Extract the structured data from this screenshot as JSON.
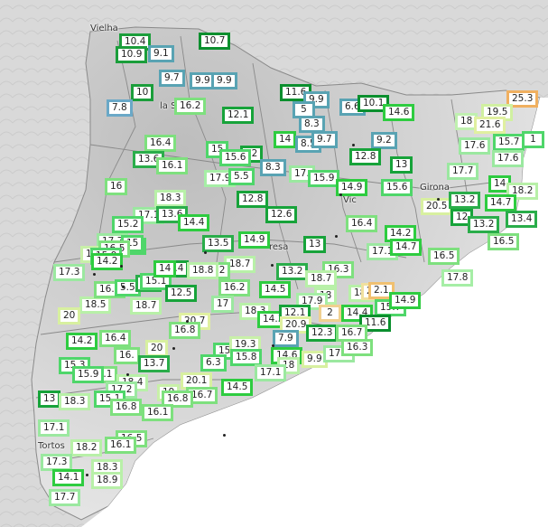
{
  "map": {
    "colors": {
      "background": "#ffffff",
      "land": "#cfcfcf",
      "borders": "#8a8a8a",
      "sea": "#ffffff"
    },
    "places": [
      {
        "name": "Vielha"
      },
      {
        "name": "la S",
        "suffix": "Urge"
      },
      {
        "name": "Girona"
      },
      {
        "name": "resa"
      },
      {
        "name": "Vic"
      },
      {
        "name": "Tortos"
      }
    ],
    "stations": [
      {
        "value": "10.4",
        "color": "#1b9e3b"
      },
      {
        "value": "10.7",
        "color": "#0b8f2e"
      },
      {
        "value": "10.9",
        "color": "#1b9e3b"
      },
      {
        "value": "9.1",
        "color": "#59a3b3"
      },
      {
        "value": "9.7",
        "color": "#59a3b3"
      },
      {
        "value": "9.9",
        "color": "#59a3b3"
      },
      {
        "value": "9.9",
        "color": "#59a3b3"
      },
      {
        "value": "10",
        "color": "#1b9e3b"
      },
      {
        "value": "7.8",
        "color": "#6aa8c7"
      },
      {
        "value": "16.2",
        "color": "#7ee07e"
      },
      {
        "value": "12.1",
        "color": "#17a33a"
      },
      {
        "value": "11.6",
        "color": "#0b8f2e"
      },
      {
        "value": "9.9",
        "color": "#59a3b3"
      },
      {
        "value": "5",
        "color": "#59a3b3"
      },
      {
        "value": "8.3",
        "color": "#59a3b3"
      },
      {
        "value": "6.6",
        "color": "#59a3b3"
      },
      {
        "value": "10.1",
        "color": "#0b8f2e"
      },
      {
        "value": "14.6",
        "color": "#2ecc40"
      },
      {
        "value": "25.3",
        "color": "#f0b060"
      },
      {
        "value": "19.5",
        "color": "#d0f0a0"
      },
      {
        "value": "18",
        "color": "#c0f0b0"
      },
      {
        "value": "21.6",
        "color": "#e0f0a0"
      },
      {
        "value": "14",
        "color": "#2ecc40"
      },
      {
        "value": "8.5",
        "color": "#59a3b3"
      },
      {
        "value": "9.7",
        "color": "#59a3b3"
      },
      {
        "value": "9.2",
        "color": "#59a3b3"
      },
      {
        "value": "16.4",
        "color": "#7ee07e"
      },
      {
        "value": "15",
        "color": "#4fd66a"
      },
      {
        "value": "12",
        "color": "#17a33a"
      },
      {
        "value": "13.6",
        "color": "#2aad4a"
      },
      {
        "value": "15.6",
        "color": "#4fd66a"
      },
      {
        "value": "8.3",
        "color": "#59a3b3"
      },
      {
        "value": "17.6",
        "color": "#9be8a0"
      },
      {
        "value": "15.7",
        "color": "#4fd66a"
      },
      {
        "value": "1",
        "color": "#4fd66a"
      },
      {
        "value": "16.1",
        "color": "#7ee07e"
      },
      {
        "value": "17.9",
        "color": "#a6eea6"
      },
      {
        "value": "5.5",
        "color": "#4fd66a"
      },
      {
        "value": "17.",
        "color": "#9be8a0"
      },
      {
        "value": "15.9",
        "color": "#4fd66a"
      },
      {
        "value": "13",
        "color": "#17a33a"
      },
      {
        "value": "12.8",
        "color": "#17a33a"
      },
      {
        "value": "17.6",
        "color": "#9be8a0"
      },
      {
        "value": "17.7",
        "color": "#9be8a0"
      },
      {
        "value": "14",
        "color": "#2ecc40"
      },
      {
        "value": "16",
        "color": "#7ee07e"
      },
      {
        "value": "14.9",
        "color": "#2ecc40"
      },
      {
        "value": "15.6",
        "color": "#4fd66a"
      },
      {
        "value": "18.2",
        "color": "#b8f0a8"
      },
      {
        "value": "18.3",
        "color": "#b8f0a8"
      },
      {
        "value": "12.8",
        "color": "#17a33a"
      },
      {
        "value": "20.5",
        "color": "#d8f0a0"
      },
      {
        "value": "13.2",
        "color": "#2aad4a"
      },
      {
        "value": "14.7",
        "color": "#2ecc40"
      },
      {
        "value": "17.1",
        "color": "#9be8a0"
      },
      {
        "value": "13.6",
        "color": "#2aad4a"
      },
      {
        "value": "12.6",
        "color": "#17a33a"
      },
      {
        "value": "12",
        "color": "#17a33a"
      },
      {
        "value": "15.2",
        "color": "#4fd66a"
      },
      {
        "value": "14.4",
        "color": "#2ecc40"
      },
      {
        "value": "16.4",
        "color": "#7ee07e"
      },
      {
        "value": "13.2",
        "color": "#2aad4a"
      },
      {
        "value": "13.4",
        "color": "#2aad4a"
      },
      {
        "value": "16.5",
        "color": "#7ee07e"
      },
      {
        "value": "17.7",
        "color": "#9be8a0"
      },
      {
        "value": "15",
        "color": "#4fd66a"
      },
      {
        "value": "15",
        "color": "#4fd66a"
      },
      {
        "value": "14.2",
        "color": "#2ecc40"
      },
      {
        "value": "13.5",
        "color": "#2aad4a"
      },
      {
        "value": "14.9",
        "color": "#2ecc40"
      },
      {
        "value": "13",
        "color": "#17a33a"
      },
      {
        "value": "17.1",
        "color": "#9be8a0"
      },
      {
        "value": "14.7",
        "color": "#2ecc40"
      },
      {
        "value": "16.5",
        "color": "#7ee07e"
      },
      {
        "value": "19",
        "color": "#c8f0a8"
      },
      {
        "value": "16.5",
        "color": "#7ee07e"
      },
      {
        "value": "15.9",
        "color": "#4fd66a"
      },
      {
        "value": "14.2",
        "color": "#2ecc40"
      },
      {
        "value": "18.7",
        "color": "#b8f0a8"
      },
      {
        "value": "17.3",
        "color": "#9be8a0"
      },
      {
        "value": "12.4",
        "color": "#17a33a"
      },
      {
        "value": "16.2",
        "color": "#7ee07e"
      },
      {
        "value": "16.3",
        "color": "#7ee07e"
      },
      {
        "value": "13.2",
        "color": "#2aad4a"
      },
      {
        "value": "17.8",
        "color": "#a6eea6"
      },
      {
        "value": "18.5",
        "color": "#b8f0a8"
      },
      {
        "value": "16.2",
        "color": "#7ee07e"
      },
      {
        "value": "5.5",
        "color": "#4fd66a"
      },
      {
        "value": "3.6",
        "color": "#2aad4a"
      },
      {
        "value": "15.1",
        "color": "#4fd66a"
      },
      {
        "value": "14",
        "color": "#2ecc40"
      },
      {
        "value": "18.8",
        "color": "#b8f0a8"
      },
      {
        "value": "16.2",
        "color": "#7ee07e"
      },
      {
        "value": "12.5",
        "color": "#17a33a"
      },
      {
        "value": "14.5",
        "color": "#2ecc40"
      },
      {
        "value": "18.7",
        "color": "#b8f0a8"
      },
      {
        "value": "18",
        "color": "#b8f0a8"
      },
      {
        "value": "18.8",
        "color": "#b8f0a8"
      },
      {
        "value": "21",
        "color": "#f0e0a0"
      },
      {
        "value": "2.1",
        "color": "#f0c070"
      },
      {
        "value": "15.7",
        "color": "#4fd66a"
      },
      {
        "value": "14.9",
        "color": "#2ecc40"
      },
      {
        "value": "18.7",
        "color": "#b8f0a8"
      },
      {
        "value": "17",
        "color": "#9be8a0"
      },
      {
        "value": "17.9",
        "color": "#a6eea6"
      },
      {
        "value": "2",
        "color": "#f0d090"
      },
      {
        "value": "14.4",
        "color": "#2ecc40"
      },
      {
        "value": "11.6",
        "color": "#0b8f2e"
      },
      {
        "value": "20",
        "color": "#d8f0a0"
      },
      {
        "value": "18.3",
        "color": "#b8f0a8"
      },
      {
        "value": "14.3",
        "color": "#2ecc40"
      },
      {
        "value": "12.1",
        "color": "#17a33a"
      },
      {
        "value": "20.9",
        "color": "#e0f0a0"
      },
      {
        "value": "20.7",
        "color": "#e0f0a0"
      },
      {
        "value": "12.3",
        "color": "#17a33a"
      },
      {
        "value": "16.7",
        "color": "#7ee07e"
      },
      {
        "value": "14.2",
        "color": "#2ecc40"
      },
      {
        "value": "16.4",
        "color": "#7ee07e"
      },
      {
        "value": "16.8",
        "color": "#7ee07e"
      },
      {
        "value": "7.9",
        "color": "#59a3b3"
      },
      {
        "value": "16.",
        "color": "#7ee07e"
      },
      {
        "value": "20",
        "color": "#d8f0a0"
      },
      {
        "value": "15",
        "color": "#4fd66a"
      },
      {
        "value": "19.3",
        "color": "#c8f0a8"
      },
      {
        "value": "14.6",
        "color": "#2ecc40"
      },
      {
        "value": "9.9",
        "color": "#d8f0a0"
      },
      {
        "value": "17.3",
        "color": "#9be8a0"
      },
      {
        "value": "16.3",
        "color": "#7ee07e"
      },
      {
        "value": "15.3",
        "color": "#4fd66a"
      },
      {
        "value": "13.7",
        "color": "#2aad4a"
      },
      {
        "value": "6.3",
        "color": "#4fd66a"
      },
      {
        "value": "15.8",
        "color": "#4fd66a"
      },
      {
        "value": "18",
        "color": "#b8f0a8"
      },
      {
        "value": "16.1",
        "color": "#7ee07e"
      },
      {
        "value": "15.9",
        "color": "#4fd66a"
      },
      {
        "value": "17.1",
        "color": "#9be8a0"
      },
      {
        "value": "20.1",
        "color": "#d8f0a0"
      },
      {
        "value": "14.5",
        "color": "#2ecc40"
      },
      {
        "value": "18.4",
        "color": "#b8f0a8"
      },
      {
        "value": "17.2",
        "color": "#9be8a0"
      },
      {
        "value": "19",
        "color": "#c8f0a8"
      },
      {
        "value": "16.7",
        "color": "#7ee07e"
      },
      {
        "value": "13",
        "color": "#17a33a"
      },
      {
        "value": "18.3",
        "color": "#b8f0a8"
      },
      {
        "value": "15.1",
        "color": "#4fd66a"
      },
      {
        "value": "16.8",
        "color": "#7ee07e"
      },
      {
        "value": "16.8",
        "color": "#7ee07e"
      },
      {
        "value": "16.1",
        "color": "#7ee07e"
      },
      {
        "value": "17.1",
        "color": "#9be8a0"
      },
      {
        "value": "16.5",
        "color": "#7ee07e"
      },
      {
        "value": "18.2",
        "color": "#b8f0a8"
      },
      {
        "value": "16.1",
        "color": "#7ee07e"
      },
      {
        "value": "17.3",
        "color": "#9be8a0"
      },
      {
        "value": "18.3",
        "color": "#b8f0a8"
      },
      {
        "value": "14.1",
        "color": "#2ecc40"
      },
      {
        "value": "18.9",
        "color": "#b8f0a8"
      },
      {
        "value": "17.7",
        "color": "#9be8a0"
      }
    ]
  }
}
